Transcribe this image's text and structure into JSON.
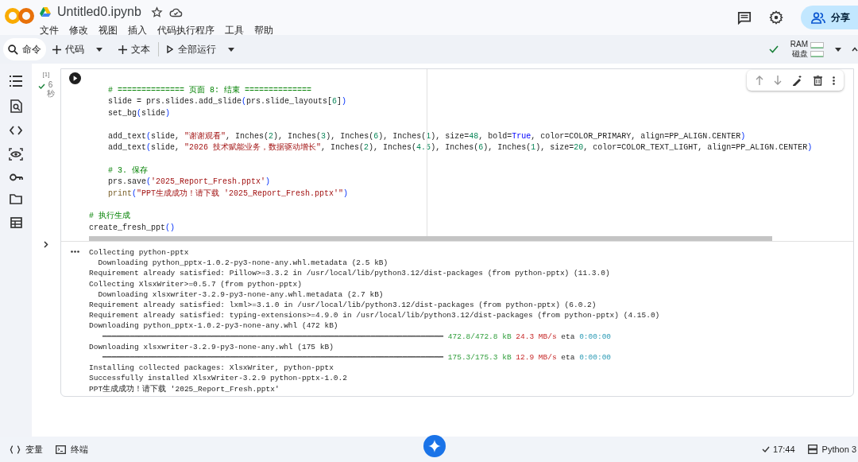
{
  "header": {
    "title": "Untitled0.ipynb",
    "menu": [
      "文件",
      "修改",
      "视图",
      "插入",
      "代码执行程序",
      "工具",
      "帮助"
    ],
    "share_button": "分享"
  },
  "toolbar": {
    "search": "命令",
    "add_code": "代码",
    "add_text": "文本",
    "run_all": "全部运行",
    "ram_label": "RAM",
    "disk_label": "磁盘"
  },
  "cell": {
    "execution_count": "[1]",
    "run_time": "6",
    "run_time_unit": "秒",
    "code_lines": [
      {
        "kind": "code",
        "tokens": [
          {
            "kind": "comment",
            "text": "    # ============== 页面 8: 结束 =============="
          }
        ]
      },
      {
        "kind": "code",
        "tokens": [
          {
            "kind": "plain",
            "text": "    slide = prs.slides.add_slide"
          },
          {
            "kind": "bracket",
            "text": "("
          },
          {
            "kind": "plain",
            "text": "prs.slide_layouts["
          },
          {
            "kind": "number",
            "text": "6"
          },
          {
            "kind": "plain",
            "text": "]"
          },
          {
            "kind": "bracket",
            "text": ")"
          }
        ]
      },
      {
        "kind": "code",
        "tokens": [
          {
            "kind": "plain",
            "text": "    set_bg"
          },
          {
            "kind": "bracket",
            "text": "("
          },
          {
            "kind": "plain",
            "text": "slide"
          },
          {
            "kind": "bracket",
            "text": ")"
          }
        ]
      },
      {
        "kind": "blank"
      },
      {
        "kind": "code",
        "tokens": [
          {
            "kind": "plain",
            "text": "    add_text"
          },
          {
            "kind": "bracket",
            "text": "("
          },
          {
            "kind": "plain",
            "text": "slide, "
          },
          {
            "kind": "string",
            "text": "\"谢谢观看\""
          },
          {
            "kind": "plain",
            "text": ", Inches("
          },
          {
            "kind": "number",
            "text": "2"
          },
          {
            "kind": "plain",
            "text": "), Inches("
          },
          {
            "kind": "number",
            "text": "3"
          },
          {
            "kind": "plain",
            "text": "), Inches("
          },
          {
            "kind": "number",
            "text": "6"
          },
          {
            "kind": "plain",
            "text": "), Inches("
          },
          {
            "kind": "number",
            "text": "1"
          },
          {
            "kind": "plain",
            "text": "), size="
          },
          {
            "kind": "number",
            "text": "48"
          },
          {
            "kind": "plain",
            "text": ", bold="
          },
          {
            "kind": "keyword",
            "text": "True"
          },
          {
            "kind": "plain",
            "text": ", color=COLOR_PRIMARY, align=PP_ALIGN.CENTER"
          },
          {
            "kind": "bracket",
            "text": ")"
          }
        ]
      },
      {
        "kind": "code",
        "tokens": [
          {
            "kind": "plain",
            "text": "    add_text"
          },
          {
            "kind": "bracket",
            "text": "("
          },
          {
            "kind": "plain",
            "text": "slide, "
          },
          {
            "kind": "string",
            "text": "\"2026 技术赋能业务，数据驱动增长\""
          },
          {
            "kind": "plain",
            "text": ", Inches("
          },
          {
            "kind": "number",
            "text": "2"
          },
          {
            "kind": "plain",
            "text": "), Inches("
          },
          {
            "kind": "number",
            "text": "4.5"
          },
          {
            "kind": "plain",
            "text": "), Inches("
          },
          {
            "kind": "number",
            "text": "6"
          },
          {
            "kind": "plain",
            "text": "), Inches("
          },
          {
            "kind": "number",
            "text": "1"
          },
          {
            "kind": "plain",
            "text": "), size="
          },
          {
            "kind": "number",
            "text": "20"
          },
          {
            "kind": "plain",
            "text": ", color=COLOR_TEXT_LIGHT, align=PP_ALIGN.CENTER"
          },
          {
            "kind": "bracket",
            "text": ")"
          }
        ]
      },
      {
        "kind": "blank"
      },
      {
        "kind": "code",
        "tokens": [
          {
            "kind": "comment",
            "text": "    # 3. 保存"
          }
        ]
      },
      {
        "kind": "code",
        "tokens": [
          {
            "kind": "plain",
            "text": "    prs.save"
          },
          {
            "kind": "bracket",
            "text": "("
          },
          {
            "kind": "string",
            "text": "'2025_Report_Fresh.pptx'"
          },
          {
            "kind": "bracket",
            "text": ")"
          }
        ]
      },
      {
        "kind": "code",
        "tokens": [
          {
            "kind": "builtin",
            "text": "    print"
          },
          {
            "kind": "bracket",
            "text": "("
          },
          {
            "kind": "string",
            "text": "\"PPT生成成功！请下载 '2025_Report_Fresh.pptx'\""
          },
          {
            "kind": "bracket",
            "text": ")"
          }
        ]
      },
      {
        "kind": "blank"
      },
      {
        "kind": "code",
        "tokens": [
          {
            "kind": "comment",
            "text": "# 执行生成"
          }
        ]
      },
      {
        "kind": "code",
        "tokens": [
          {
            "kind": "plain",
            "text": "create_fresh_ppt"
          },
          {
            "kind": "bracket",
            "text": "()"
          }
        ]
      }
    ],
    "output_lines": [
      [
        {
          "kind": "plain",
          "text": "Collecting python-pptx"
        }
      ],
      [
        {
          "kind": "plain",
          "text": "  Downloading python_pptx-1.0.2-py3-none-any.whl.metadata (2.5 kB)"
        }
      ],
      [
        {
          "kind": "plain",
          "text": "Requirement already satisfied: Pillow>=3.3.2 in /usr/local/lib/python3.12/dist-packages (from python-pptx) (11.3.0)"
        }
      ],
      [
        {
          "kind": "plain",
          "text": "Collecting XlsxWriter>=0.5.7 (from python-pptx)"
        }
      ],
      [
        {
          "kind": "plain",
          "text": "  Downloading xlsxwriter-3.2.9-py3-none-any.whl.metadata (2.7 kB)"
        }
      ],
      [
        {
          "kind": "plain",
          "text": "Requirement already satisfied: lxml>=3.1.0 in /usr/local/lib/python3.12/dist-packages (from python-pptx) (6.0.2)"
        }
      ],
      [
        {
          "kind": "plain",
          "text": "Requirement already satisfied: typing-extensions>=4.9.0 in /usr/local/lib/python3.12/dist-packages (from python-pptx) (4.15.0)"
        }
      ],
      [
        {
          "kind": "plain",
          "text": "Downloading python_pptx-1.0.2-py3-none-any.whl (472 kB)"
        }
      ],
      [
        {
          "kind": "bar",
          "text": "   ━━━━━━━━━━━━━━━━━━━━━━━━━━━━━━━━━━━━━━━━━━━━━━━━━━━━━━━━━━━━━━━━━━━━━━━━━━━"
        },
        {
          "kind": "done",
          "text": " 472.8/472.8 kB"
        },
        {
          "kind": "speed",
          "text": " 24.3 MB/s"
        },
        {
          "kind": "plain",
          "text": " eta "
        },
        {
          "kind": "eta",
          "text": "0:00:00"
        }
      ],
      [
        {
          "kind": "plain",
          "text": "Downloading xlsxwriter-3.2.9-py3-none-any.whl (175 kB)"
        }
      ],
      [
        {
          "kind": "bar",
          "text": "   ━━━━━━━━━━━━━━━━━━━━━━━━━━━━━━━━━━━━━━━━━━━━━━━━━━━━━━━━━━━━━━━━━━━━━━━━━━━"
        },
        {
          "kind": "done",
          "text": " 175.3/175.3 kB"
        },
        {
          "kind": "speed",
          "text": " 12.9 MB/s"
        },
        {
          "kind": "plain",
          "text": " eta "
        },
        {
          "kind": "eta",
          "text": "0:00:00"
        }
      ],
      [
        {
          "kind": "plain",
          "text": "Installing collected packages: XlsxWriter, python-pptx"
        }
      ],
      [
        {
          "kind": "plain",
          "text": "Successfully installed XlsxWriter-3.2.9 python-pptx-1.0.2"
        }
      ],
      [
        {
          "kind": "plain",
          "text": "PPT生成成功！请下载 '2025_Report_Fresh.pptx'"
        }
      ]
    ]
  },
  "footer": {
    "variables": "变量",
    "terminal": "终端",
    "time": "17:44",
    "runtime": "Python 3"
  }
}
